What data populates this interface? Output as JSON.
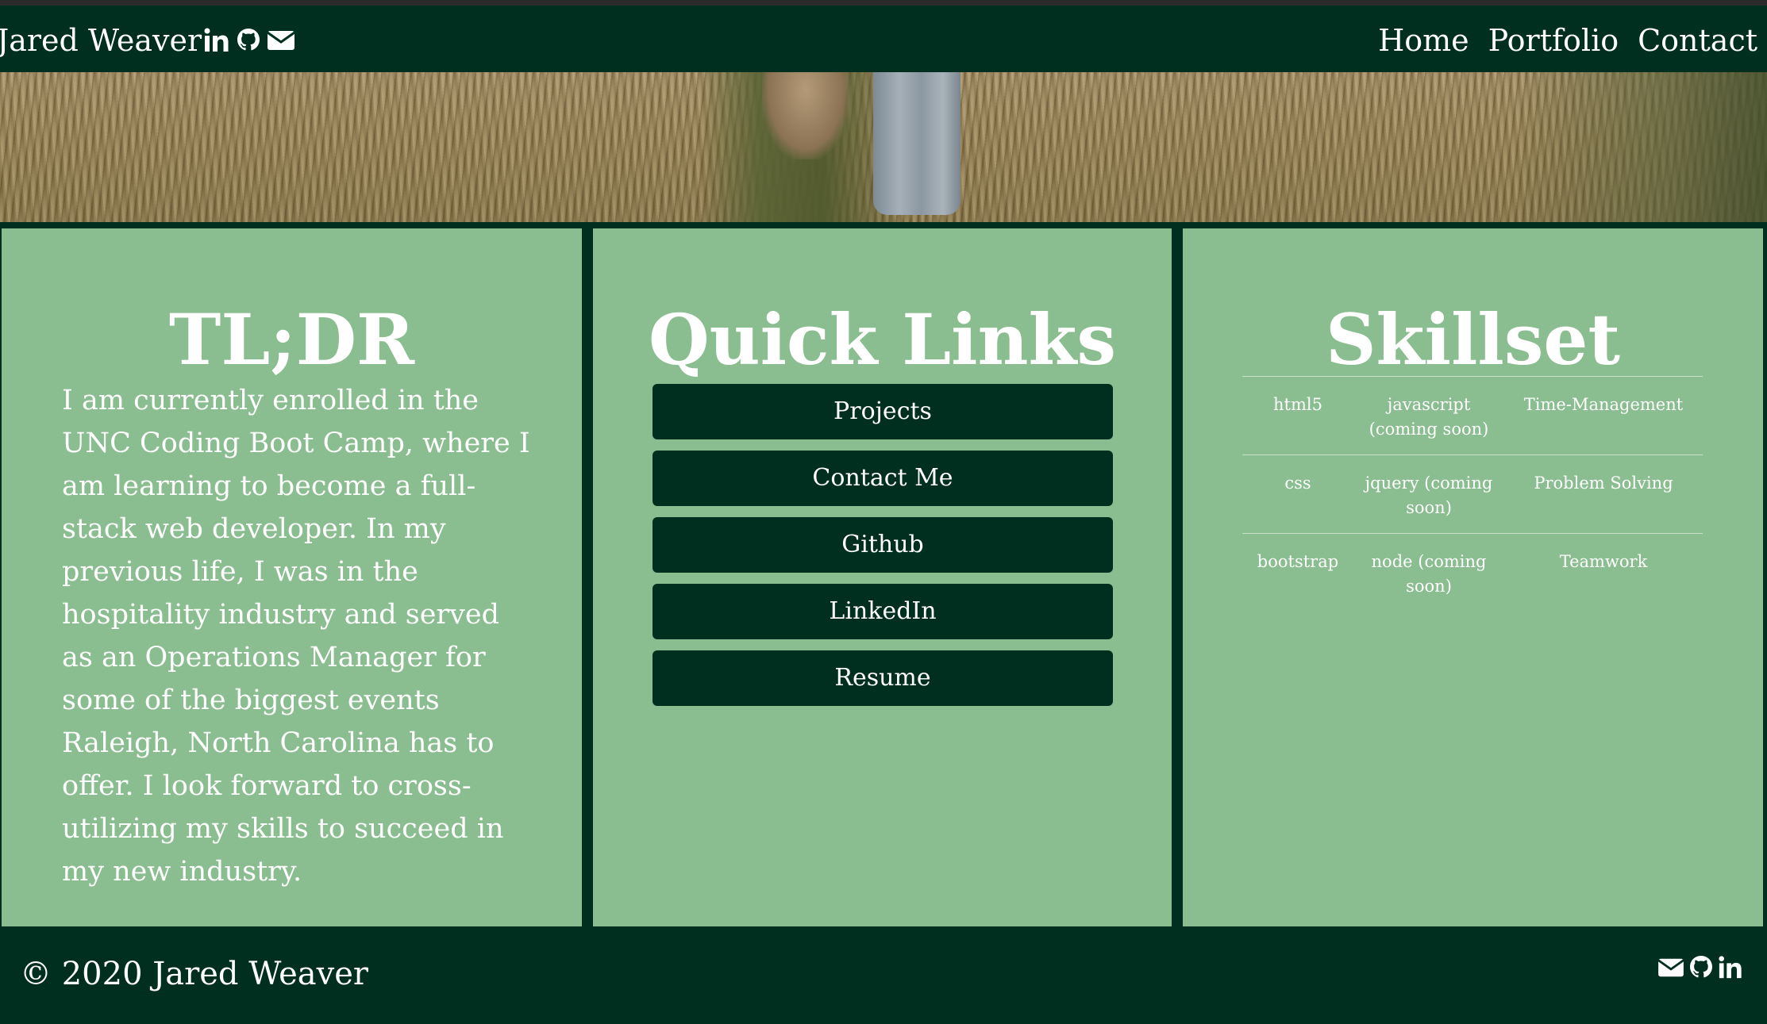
{
  "navbar": {
    "brand": "Jared Weaver",
    "social_icons": [
      "linkedin-icon",
      "github-icon",
      "envelope-icon"
    ],
    "links": [
      "Home",
      "Portfolio",
      "Contact"
    ]
  },
  "tldr": {
    "title": "TL;DR",
    "text": "I am currently enrolled in the UNC Coding Boot Camp, where I am learning to become a full-stack web developer. In my previous life, I was in the hospitality industry and served as an Operations Manager for some of the biggest events Raleigh, North Carolina has to offer. I look forward to cross-utilizing my skills to succeed in my new industry."
  },
  "quick_links": {
    "title": "Quick Links",
    "buttons": [
      "Projects",
      "Contact Me",
      "Github",
      "LinkedIn",
      "Resume"
    ]
  },
  "skillset": {
    "title": "Skillset",
    "rows": [
      [
        "html5",
        "javascript (coming soon)",
        "Time-Management"
      ],
      [
        "css",
        "jquery (coming soon)",
        "Problem Solving"
      ],
      [
        "bootstrap",
        "node (coming soon)",
        "Teamwork"
      ]
    ]
  },
  "footer": {
    "copyright": "© 2020 Jared Weaver",
    "social_icons": [
      "envelope-icon",
      "github-icon",
      "linkedin-icon"
    ]
  },
  "colors": {
    "dark_green": "#002e1f",
    "panel_green": "#8abd8f",
    "text": "#ffffff"
  }
}
